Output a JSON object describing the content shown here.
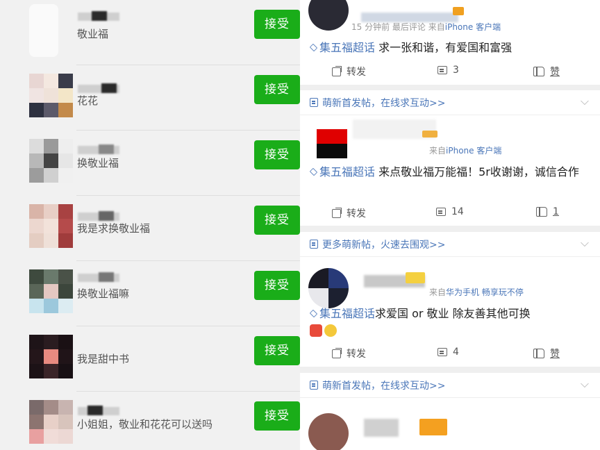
{
  "left": {
    "accept_label": "接受",
    "requests": [
      {
        "message": "敬业福"
      },
      {
        "message": "花花"
      },
      {
        "message": "换敬业福"
      },
      {
        "message": "我是求换敬业福"
      },
      {
        "message": "换敬业福嘛"
      },
      {
        "message": "我是甜中书"
      },
      {
        "message": "小姐姐，敬业和花花可以送吗"
      }
    ]
  },
  "right": {
    "post1": {
      "source_time": "15 分钟前  最后评论",
      "source_prefix": "来自",
      "source_device": "iPhone 客户端",
      "topic": "集五福超话",
      "text": " 求一张和谐，有爱国和富强",
      "repost_label": "转发",
      "comment_count": "3",
      "like_label": "赞"
    },
    "header1": {
      "text": "萌新首发帖，在线求互动>>"
    },
    "post2": {
      "source_prefix": "来自",
      "source_device": "iPhone 客户端",
      "topic": "集五福超话",
      "text": " 来点敬业福万能福！5r收谢谢，诚信合作",
      "repost_label": "转发",
      "comment_count": "14",
      "like_count": "1"
    },
    "header2": {
      "text": "更多萌新帖，火速去围观>>"
    },
    "post3": {
      "source_prefix": "来自",
      "source_device": "华为手机 畅享玩不停",
      "topic": "集五福超话",
      "text": "求爱国 or 敬业   除友善其他可换",
      "repost_label": "转发",
      "comment_count": "4",
      "like_label": "赞"
    },
    "header3": {
      "text": "萌新首发帖，在线求互动>>"
    }
  },
  "colors": {
    "accept_green": "#1aad19",
    "weibo_link": "#4a76b8"
  }
}
